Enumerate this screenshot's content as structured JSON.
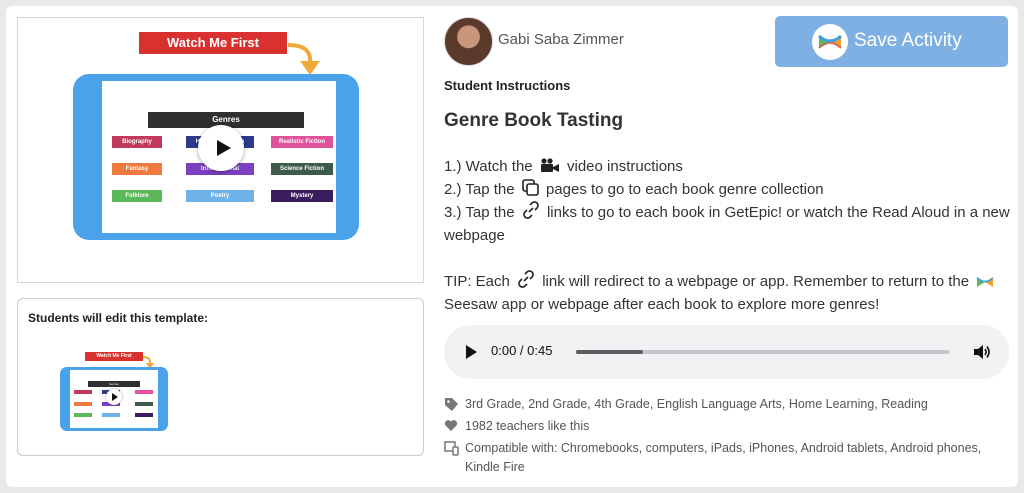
{
  "video": {
    "banner": "Watch Me First",
    "genres_title": "Genres",
    "genres": [
      "Biography",
      "Historical Fiction",
      "Realistic Fiction",
      "Fantasy",
      "Informational",
      "Science Fiction",
      "Folklore",
      "Poetry",
      "Mystery"
    ],
    "genre_colors": [
      "#c2395b",
      "#2d3a8c",
      "#e0529b",
      "#ee7a3f",
      "#7b3fbf",
      "#3d5a4a",
      "#5bb85a",
      "#6fb2e8",
      "#3a1d5e"
    ]
  },
  "template": {
    "title": "Students will edit this template:",
    "banner": "Watch Me First",
    "genres_title": "Genres"
  },
  "author": {
    "name": "Gabi Saba Zimmer"
  },
  "save_button": {
    "label": "Save Activity"
  },
  "instructions": {
    "heading": "Student Instructions",
    "title": "Genre Book Tasting",
    "step1_prefix": "1.) Watch the",
    "step1_suffix": "video instructions",
    "step2_prefix": "2.) Tap the",
    "step2_suffix": "pages to go to each book genre collection",
    "step3_prefix": "3.) Tap the",
    "step3_suffix": "links to go to each book in GetEpic! or watch the Read Aloud in a new webpage",
    "tip_prefix": "TIP: Each",
    "tip_middle": "link will redirect to a webpage or app. Remember to return to the",
    "tip_suffix": "Seesaw app or webpage after each book to explore more genres!"
  },
  "audio": {
    "time": "0:00 / 0:45",
    "progress": 0.18
  },
  "meta": {
    "grades": "3rd Grade, 2nd Grade, 4th Grade, English Language Arts, Home Learning, Reading",
    "likes": "1982 teachers like this",
    "compatible": "Compatible with: Chromebooks, computers, iPads, iPhones, Android tablets, Android phones, Kindle Fire"
  },
  "colors": {
    "accent": "#7fb0e4",
    "banner_red": "#d9312f",
    "tablet_blue": "#4aa3ea"
  },
  "icons": [
    "video-camera-icon",
    "pages-icon",
    "link-icon",
    "seesaw-logo-icon",
    "tag-icon",
    "heart-icon",
    "device-icon",
    "volume-icon",
    "play-icon"
  ]
}
